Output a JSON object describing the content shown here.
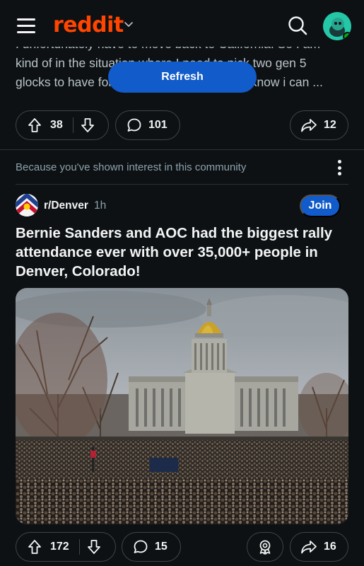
{
  "header": {
    "logo_text": "reddit",
    "brand_color": "#ff4500"
  },
  "previous_post": {
    "text_lines": [
      "I unfortunately have to move back to California. So I am",
      "kind of in the situation where I need to pick two gen 5",
      "glocks to have for the foreseeable future (I know i can ..."
    ],
    "upvotes": "38",
    "comments": "101",
    "shares": "12"
  },
  "refresh": {
    "label": "Refresh"
  },
  "recommendation": {
    "reason": "Because you've shown interest in this community"
  },
  "post": {
    "subreddit": "r/Denver",
    "age": "1h",
    "join_label": "Join",
    "title": "Bernie Sanders and AOC had the biggest rally attendance ever with over 35,000+ people in Denver, Colorado!",
    "upvotes": "172",
    "comments": "15",
    "shares": "16"
  },
  "icons": [
    "menu-icon",
    "chevron-down-icon",
    "search-icon",
    "avatar",
    "upvote-icon",
    "downvote-icon",
    "comment-icon",
    "share-icon",
    "award-icon",
    "more-icon"
  ],
  "colors": {
    "background": "#0e1113",
    "accent_blue": "#115bca",
    "muted_text": "#8ba2ad"
  }
}
